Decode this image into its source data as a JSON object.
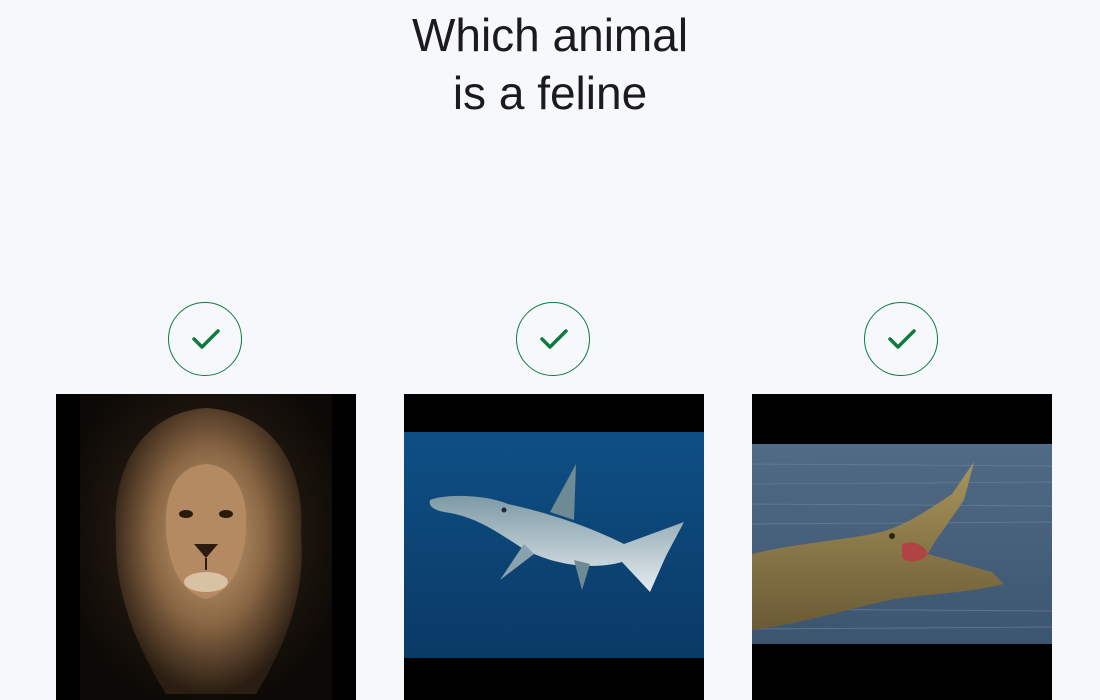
{
  "question": {
    "line1": "Which animal",
    "line2": "is a feline"
  },
  "options": [
    {
      "animal": "lion",
      "icon": "checkmark-icon",
      "selected": true
    },
    {
      "animal": "hammerhead shark",
      "icon": "checkmark-icon",
      "selected": true
    },
    {
      "animal": "crocodile",
      "icon": "checkmark-icon",
      "selected": true
    }
  ],
  "colors": {
    "background": "#f7f8fc",
    "check_accent": "#0f7b3e",
    "title_text": "#1b1b1b"
  }
}
